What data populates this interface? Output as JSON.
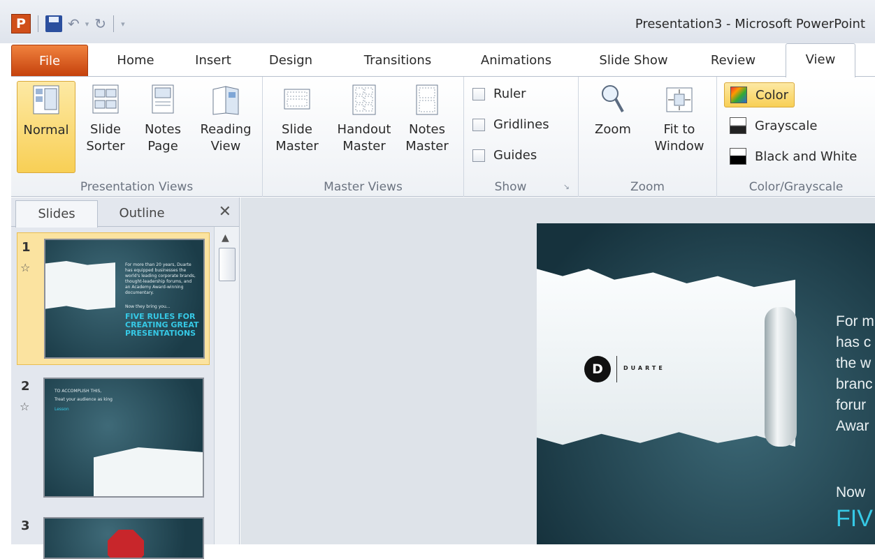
{
  "window": {
    "title": "Presentation3  -  Microsoft PowerPoint",
    "app_icon": "P"
  },
  "quick_access": [
    "save-icon",
    "undo-icon",
    "redo-icon",
    "customize-icon"
  ],
  "tabs": [
    {
      "label": "File"
    },
    {
      "label": "Home"
    },
    {
      "label": "Insert"
    },
    {
      "label": "Design"
    },
    {
      "label": "Transitions"
    },
    {
      "label": "Animations"
    },
    {
      "label": "Slide Show"
    },
    {
      "label": "Review"
    },
    {
      "label": "View"
    }
  ],
  "ribbon": {
    "presentation_views": {
      "label": "Presentation Views",
      "buttons": [
        {
          "label": "Normal",
          "selected": true
        },
        {
          "label": "Slide\nSorter"
        },
        {
          "label": "Notes\nPage"
        },
        {
          "label": "Reading\nView"
        }
      ]
    },
    "master_views": {
      "label": "Master Views",
      "buttons": [
        {
          "label": "Slide\nMaster"
        },
        {
          "label": "Handout\nMaster"
        },
        {
          "label": "Notes\nMaster"
        }
      ]
    },
    "show": {
      "label": "Show",
      "checks": [
        "Ruler",
        "Gridlines",
        "Guides"
      ]
    },
    "zoom": {
      "label": "Zoom",
      "buttons": [
        {
          "label": "Zoom"
        },
        {
          "label": "Fit to\nWindow"
        }
      ]
    },
    "color": {
      "label": "Color/Grayscale",
      "options": [
        {
          "label": "Color",
          "selected": true
        },
        {
          "label": "Grayscale"
        },
        {
          "label": "Black and White"
        }
      ]
    }
  },
  "pane": {
    "tabs": [
      "Slides",
      "Outline"
    ],
    "slides": [
      {
        "number": "1",
        "selected": true,
        "text_small": "For more than 20 years, Duarte has equipped businesses the world's leading corporate brands, thought-leadership forums, and an Academy Award-winning documentary.",
        "text_mid": "Now they bring you...",
        "text_cyan": "FIVE RULES FOR CREATING GREAT PRESENTATIONS"
      },
      {
        "number": "2",
        "text_small": "TO ACCOMPLISH THIS,",
        "text_mid": "Treat your audience as king",
        "text_cyan": "Lesson"
      },
      {
        "number": "3"
      }
    ]
  },
  "slide": {
    "logo_letter": "D",
    "logo_word": "DUARTE",
    "body_lines": [
      "For m",
      "has c",
      "the w",
      "branc",
      "forur",
      "Awar"
    ],
    "now_line": "Now",
    "five_line": "FIV"
  },
  "colors": {
    "accent": "#36c9e6",
    "file_tab": "#d04f1a",
    "selected": "#f8cf55"
  }
}
